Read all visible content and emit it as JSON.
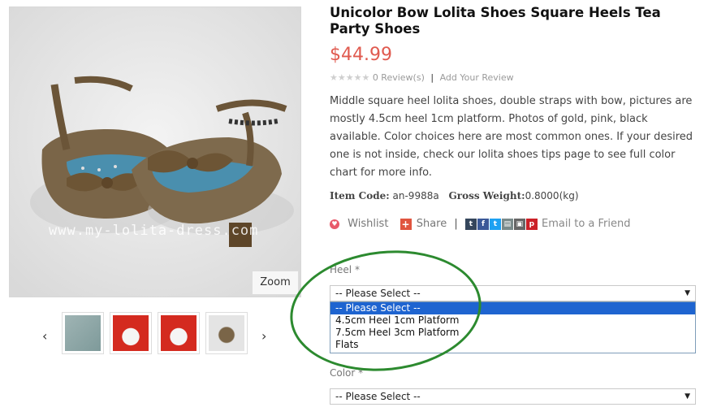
{
  "image": {
    "watermark": "www.my-lolita-dress.com",
    "zoom_label": "Zoom"
  },
  "thumbnails": {
    "prev": "‹",
    "next": "›",
    "count": 4
  },
  "product": {
    "title": "Unicolor Bow Lolita Shoes Square Heels Tea Party Shoes",
    "price": "$44.99",
    "stars": "★★★★★",
    "reviews": "0 Review(s)",
    "separator": "|",
    "add_review": "Add Your Review",
    "description": "Middle square heel lolita shoes, double straps with bow, pictures are mostly 4.5cm heel 1cm platform. Photos of gold, pink, black available. Color choices here are most common ones. If your desired one is not inside, check our lolita shoes tips page to see full color chart for more info.",
    "item_code_label": "Item Code:",
    "item_code": "an-9988a",
    "gross_weight_label": "Gross Weight:",
    "gross_weight": "0.8000(kg)"
  },
  "actions": {
    "wishlist": "Wishlist",
    "share": "Share",
    "email": "Email to a Friend",
    "share_icons": [
      "tumblr-icon",
      "facebook-icon",
      "twitter-icon",
      "print-icon",
      "save-icon",
      "pinterest-icon"
    ]
  },
  "options": {
    "heel_label": "Heel *",
    "heel_value": "-- Please Select --",
    "heel_options": [
      "-- Please Select --",
      "4.5cm Heel 1cm Platform",
      "7.5cm Heel 3cm Platform",
      "Flats"
    ],
    "color_label": "Color *",
    "color_value": "-- Please Select --"
  },
  "colors": {
    "price": "#e05a4f",
    "selected_option": "#1e64d0",
    "annotation_ellipse": "#2c8a2f"
  }
}
